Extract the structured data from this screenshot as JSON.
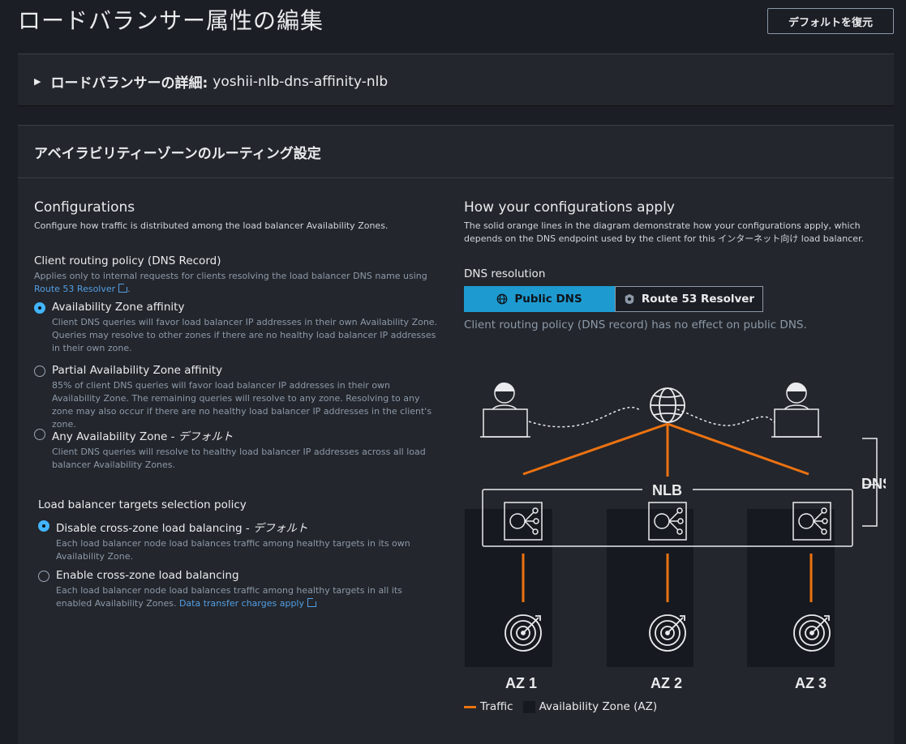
{
  "page": {
    "title": "ロードバランサー属性の編集",
    "reset_button": "デフォルトを復元"
  },
  "details": {
    "label": "ロードバランサーの詳細:",
    "name": "yoshii-nlb-dns-affinity-nlb"
  },
  "routing": {
    "header": "アベイラビリティーゾーンのルーティング設定",
    "configurations": {
      "title": "Configurations",
      "description": "Configure how traffic is distributed among the load balancer Availability Zones."
    },
    "client_policy": {
      "label": "Client routing policy (DNS Record)",
      "help_prefix": "Applies only to internal requests for clients resolving the load balancer DNS name using",
      "help_link": "Route 53 Resolver",
      "help_suffix": ".",
      "options": [
        {
          "title": "Availability Zone affinity",
          "suffix": "",
          "desc": "Client DNS queries will favor load balancer IP addresses in their own Availability Zone. Queries may resolve to other zones if there are no healthy load balancer IP addresses in their own zone.",
          "checked": true
        },
        {
          "title": "Partial Availability Zone affinity",
          "suffix": "",
          "desc": "85% of client DNS queries will favor load balancer IP addresses in their own Availability Zone. The remaining queries will resolve to any zone. Resolving to any zone may also occur if there are no healthy load balancer IP addresses in the client's zone.",
          "checked": false
        },
        {
          "title": "Any Availability Zone - ",
          "suffix": "デフォルト",
          "desc": "Client DNS queries will resolve to healthy load balancer IP addresses across all load balancer Availability Zones.",
          "checked": false
        }
      ]
    },
    "target_policy": {
      "label": "Load balancer targets selection policy",
      "options": [
        {
          "title": "Disable cross-zone load balancing - ",
          "suffix": "デフォルト",
          "desc": "Each load balancer node load balances traffic among healthy targets in its own Availability Zone.",
          "checked": true
        },
        {
          "title": "Enable cross-zone load balancing",
          "suffix": "",
          "desc": "Each load balancer node load balances traffic among healthy targets in all its enabled Availability Zones.",
          "link": "Data transfer charges apply",
          "checked": false
        }
      ]
    },
    "how": {
      "title": "How your configurations apply",
      "description": "The solid orange lines in the diagram demonstrate how your configurations apply, which depends on the DNS endpoint used by the client for this インターネット向け load balancer.",
      "dns_resolution_label": "DNS resolution",
      "seg_public": "Public DNS",
      "seg_resolver": "Route 53 Resolver",
      "note": "Client routing policy (DNS record) has no effect on public DNS."
    },
    "diagram": {
      "dns_label": "DNS",
      "nlb_label": "NLB",
      "az_labels": [
        "AZ 1",
        "AZ 2",
        "AZ 3"
      ],
      "legend_traffic": "Traffic",
      "legend_az": "Availability Zone (AZ)",
      "colors": {
        "traffic": "#ec7211",
        "az_bg": "#16191f",
        "line": "#e9ebed"
      }
    }
  }
}
